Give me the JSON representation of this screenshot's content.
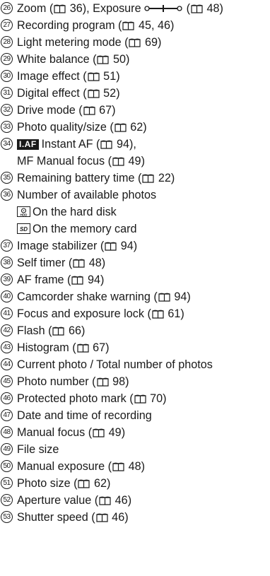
{
  "items": [
    {
      "num": "26",
      "text": "Zoom (",
      "p1": "36",
      "mid": "), Exposure",
      "p2": "48"
    },
    {
      "num": "27",
      "text": "Recording program (",
      "ref": "45, 46",
      "end": ")"
    },
    {
      "num": "28",
      "text": "Light metering mode (",
      "ref": "69",
      "end": ")"
    },
    {
      "num": "29",
      "text": "White balance (",
      "ref": "50",
      "end": ")"
    },
    {
      "num": "30",
      "text": "Image effect (",
      "ref": "51",
      "end": ")"
    },
    {
      "num": "31",
      "text": "Digital effect (",
      "ref": "52",
      "end": ")"
    },
    {
      "num": "32",
      "text": "Drive mode (",
      "ref": "67",
      "end": ")"
    },
    {
      "num": "33",
      "text": "Photo quality/size (",
      "ref": "62",
      "end": ")"
    },
    {
      "num": "34",
      "badge": "I.AF",
      "text": "Instant AF (",
      "ref": "94",
      "end": "),"
    },
    {
      "sub": true,
      "text": "MF Manual focus (",
      "ref": "49",
      "end": ")"
    },
    {
      "num": "35",
      "text": "Remaining battery time (",
      "ref": "22",
      "end": ")"
    },
    {
      "num": "36",
      "text": "Number of available photos"
    },
    {
      "sub": true,
      "icon": "hdd-icon",
      "plain": "On the hard disk"
    },
    {
      "sub": true,
      "icon": "sd-card-icon",
      "plain": "On the memory card"
    },
    {
      "num": "37",
      "text": "Image stabilizer (",
      "ref": "94",
      "end": ")"
    },
    {
      "num": "38",
      "text": "Self timer (",
      "ref": "48",
      "end": ")"
    },
    {
      "num": "39",
      "text": "AF frame (",
      "ref": "94",
      "end": ")"
    },
    {
      "num": "40",
      "text": "Camcorder shake warning (",
      "ref": "94",
      "end": ")"
    },
    {
      "num": "41",
      "text": "Focus and exposure lock (",
      "ref": "61",
      "end": ")"
    },
    {
      "num": "42",
      "text": "Flash (",
      "ref": "66",
      "end": ")"
    },
    {
      "num": "43",
      "text": "Histogram (",
      "ref": "67",
      "end": ")"
    },
    {
      "num": "44",
      "text": "Current photo / Total number of photos"
    },
    {
      "num": "45",
      "text": "Photo number (",
      "ref": "98",
      "end": ")"
    },
    {
      "num": "46",
      "text": "Protected photo mark (",
      "ref": "70",
      "end": ")"
    },
    {
      "num": "47",
      "text": "Date and time of recording"
    },
    {
      "num": "48",
      "text": "Manual focus (",
      "ref": "49",
      "end": ")"
    },
    {
      "num": "49",
      "text": "File size"
    },
    {
      "num": "50",
      "text": "Manual exposure (",
      "ref": "48",
      "end": ")"
    },
    {
      "num": "51",
      "text": "Photo size (",
      "ref": "62",
      "end": ")"
    },
    {
      "num": "52",
      "text": "Aperture value (",
      "ref": "46",
      "end": ")"
    },
    {
      "num": "53",
      "text": "Shutter speed (",
      "ref": "46",
      "end": ")"
    }
  ],
  "icons": {
    "book": "book-reference-icon",
    "exposure": "exposure-slider-icon"
  }
}
